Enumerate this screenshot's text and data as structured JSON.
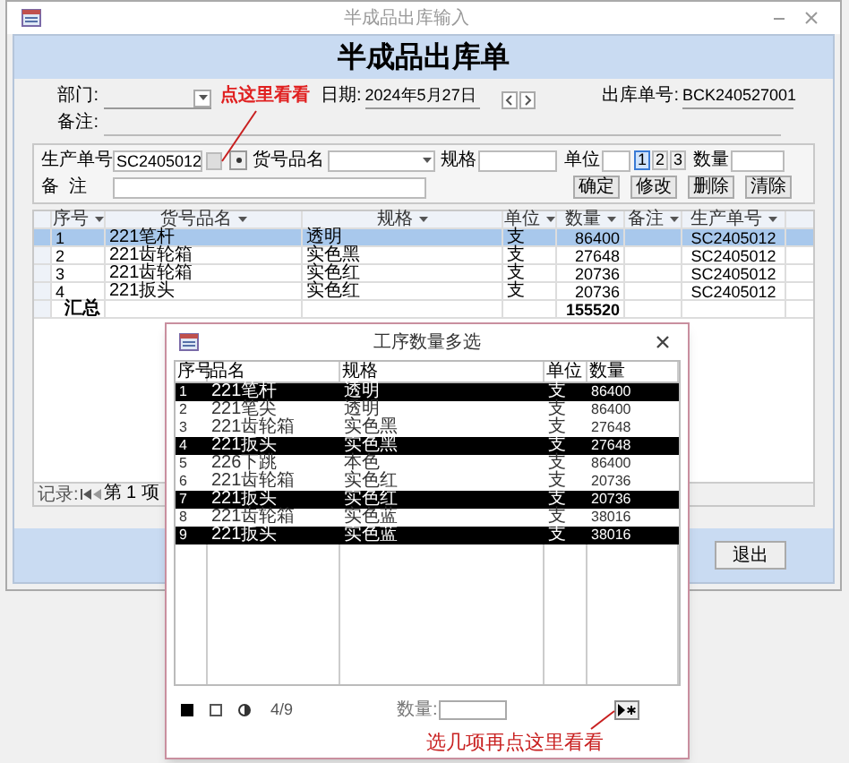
{
  "window": {
    "title": "半成品出库输入"
  },
  "header": {
    "title": "半成品出库单"
  },
  "form": {
    "department": {
      "label": "部门:"
    },
    "annotation": "点这里看看",
    "date": {
      "label": "日期:",
      "value": "2024年5月27日"
    },
    "order_no": {
      "label": "出库单号:",
      "value": "BCK240527001"
    },
    "remark": {
      "label": "备注:"
    }
  },
  "entry": {
    "production_no": {
      "label": "生产单号",
      "value": "SC2405012"
    },
    "item_name": {
      "label": "货号品名"
    },
    "spec": {
      "label": "规格"
    },
    "unit": {
      "label": "单位",
      "options": [
        {
          "label": "1",
          "selected": true
        },
        {
          "label": "2",
          "selected": false
        },
        {
          "label": "3",
          "selected": false
        }
      ]
    },
    "quantity": {
      "label": "数量"
    },
    "remark": {
      "label": "备  注"
    },
    "buttons": [
      "确定",
      "修改",
      "删除",
      "清除"
    ]
  },
  "table": {
    "columns": [
      "序号",
      "货号品名",
      "规格",
      "单位",
      "数量",
      "备注",
      "生产单号"
    ],
    "rows": [
      {
        "selected": true,
        "cells": [
          "1",
          "221笔杆",
          "透明",
          "支",
          "86400",
          "",
          "SC2405012"
        ]
      },
      {
        "selected": false,
        "cells": [
          "2",
          "221齿轮箱",
          "实色黑",
          "支",
          "27648",
          "",
          "SC2405012"
        ]
      },
      {
        "selected": false,
        "cells": [
          "3",
          "221齿轮箱",
          "实色红",
          "支",
          "20736",
          "",
          "SC2405012"
        ]
      },
      {
        "selected": false,
        "cells": [
          "4",
          "221扳头",
          "实色红",
          "支",
          "20736",
          "",
          "SC2405012"
        ]
      }
    ],
    "summary": {
      "label": "汇总",
      "total": "155520"
    }
  },
  "record_nav": {
    "label": "记录:",
    "position": "第 1 项"
  },
  "exit_button": "退出",
  "dialog": {
    "title": "工序数量多选",
    "columns": [
      "序号",
      "品名",
      "规格",
      "单位",
      "数量"
    ],
    "rows": [
      {
        "selected": true,
        "cells": [
          "1",
          "221笔杆",
          "透明",
          "支",
          "86400"
        ]
      },
      {
        "selected": false,
        "cells": [
          "2",
          "221笔尖",
          "透明",
          "支",
          "86400"
        ]
      },
      {
        "selected": false,
        "cells": [
          "3",
          "221齿轮箱",
          "实色黑",
          "支",
          "27648"
        ]
      },
      {
        "selected": true,
        "cells": [
          "4",
          "221扳头",
          "实色黑",
          "支",
          "27648"
        ]
      },
      {
        "selected": false,
        "cells": [
          "5",
          "226下跳",
          "本色",
          "支",
          "86400"
        ]
      },
      {
        "selected": false,
        "cells": [
          "6",
          "221齿轮箱",
          "实色红",
          "支",
          "20736"
        ]
      },
      {
        "selected": true,
        "cells": [
          "7",
          "221扳头",
          "实色红",
          "支",
          "20736"
        ]
      },
      {
        "selected": false,
        "cells": [
          "8",
          "221齿轮箱",
          "实色蓝",
          "支",
          "38016"
        ]
      },
      {
        "selected": true,
        "cells": [
          "9",
          "221扳头",
          "实色蓝",
          "支",
          "38016"
        ]
      }
    ],
    "count": "4/9",
    "quantity_label": "数量:",
    "annotation": "选几项再点这里看看"
  }
}
